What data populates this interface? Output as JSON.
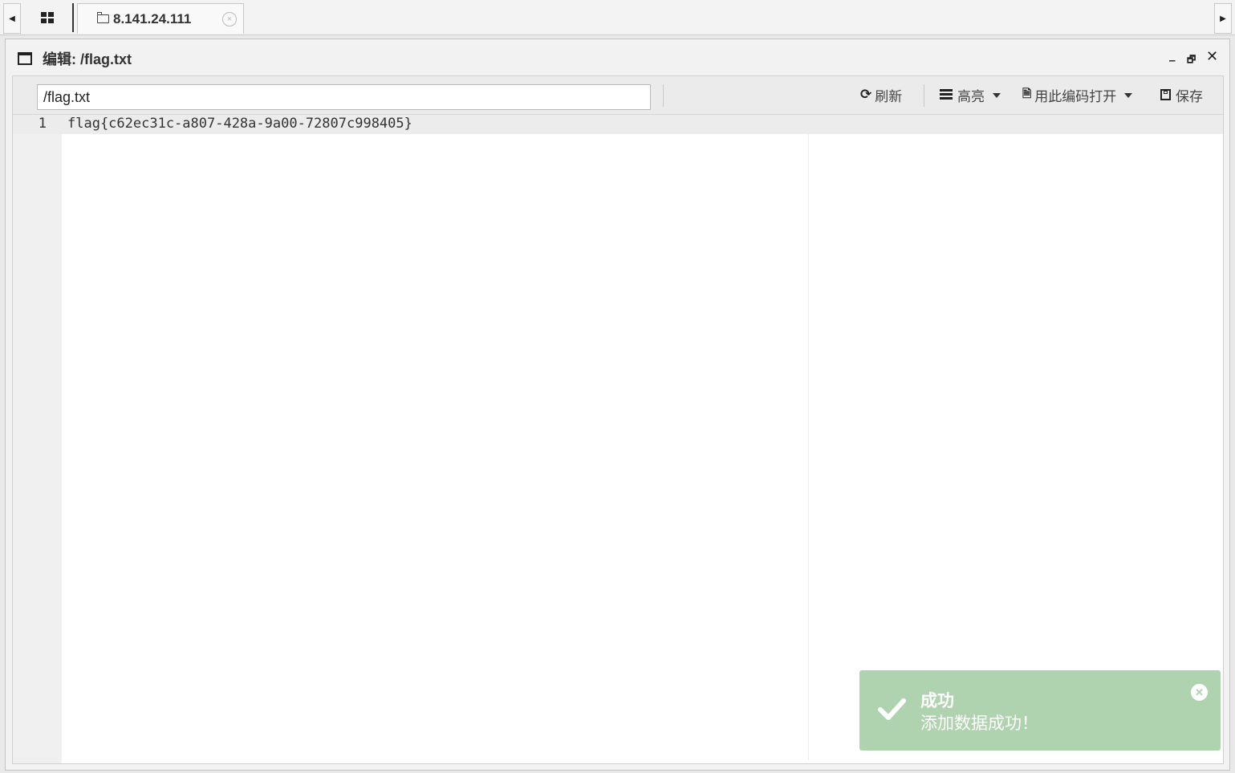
{
  "tabs": {
    "active_label": "8.141.24.111",
    "close_symbol": "×"
  },
  "window": {
    "title": "编辑: /flag.txt"
  },
  "toolbar": {
    "path_value": "/flag.txt",
    "refresh_label": "刷新",
    "highlight_label": "高亮",
    "encoding_label": "用此编码打开",
    "save_label": "保存"
  },
  "editor": {
    "line_number": "1",
    "line_text": "flag{c62ec31c-a807-428a-9a00-72807c998405}"
  },
  "toast": {
    "title": "成功",
    "message": "添加数据成功！",
    "color": "#aed3ae"
  }
}
